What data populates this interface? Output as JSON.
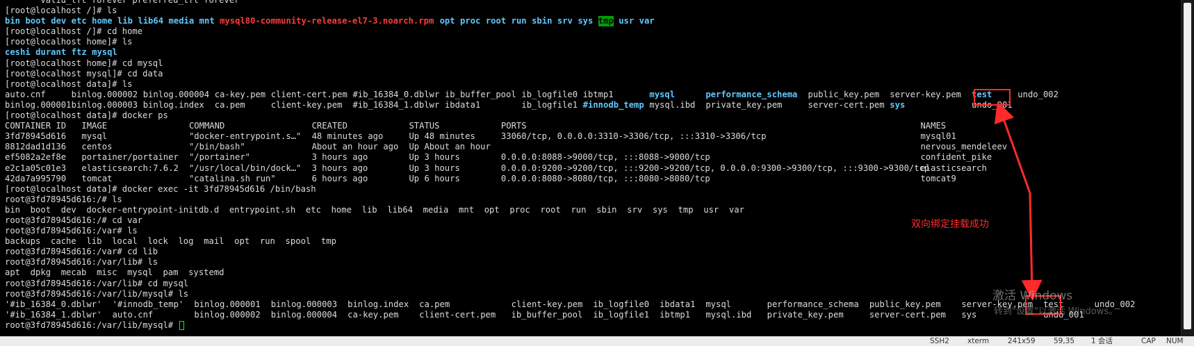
{
  "terminal": {
    "lines": [
      {
        "tokens": [
          {
            "text": "       valid_lft forever preferred_lft forever",
            "c": "default",
            "col": 0
          }
        ]
      },
      {
        "tokens": [
          {
            "text": "[root@localhost /]# ls",
            "c": "default",
            "col": 0
          }
        ]
      },
      {
        "tokens": [
          {
            "text": "bin",
            "c": "dir",
            "col": 0
          },
          {
            "text": "boot",
            "c": "dir",
            "col": 4
          },
          {
            "text": "dev",
            "c": "dir",
            "col": 9
          },
          {
            "text": "etc",
            "c": "dir",
            "col": 13
          },
          {
            "text": "home",
            "c": "dir",
            "col": 17
          },
          {
            "text": "lib",
            "c": "dir",
            "col": 22
          },
          {
            "text": "lib64",
            "c": "dir",
            "col": 26
          },
          {
            "text": "media",
            "c": "dir",
            "col": 32
          },
          {
            "text": "mnt",
            "c": "dir",
            "col": 38
          },
          {
            "text": "mysql80-community-release-el7-3.noarch.rpm",
            "c": "red",
            "col": 42
          },
          {
            "text": "opt",
            "c": "dir",
            "col": 85
          },
          {
            "text": "proc",
            "c": "dir",
            "col": 89
          },
          {
            "text": "root",
            "c": "dir",
            "col": 94
          },
          {
            "text": "run",
            "c": "dir",
            "col": 99
          },
          {
            "text": "sbin",
            "c": "dir",
            "col": 103
          },
          {
            "text": "srv",
            "c": "dir",
            "col": 108
          },
          {
            "text": "sys",
            "c": "dir",
            "col": 112
          },
          {
            "text": "tmp",
            "c": "tmpbg",
            "col": 116
          },
          {
            "text": "usr",
            "c": "dir",
            "col": 120
          },
          {
            "text": "var",
            "c": "dir",
            "col": 124
          }
        ]
      },
      {
        "tokens": [
          {
            "text": "[root@localhost /]# cd home",
            "c": "default",
            "col": 0
          }
        ]
      },
      {
        "tokens": [
          {
            "text": "[root@localhost home]# ls",
            "c": "default",
            "col": 0
          }
        ]
      },
      {
        "tokens": [
          {
            "text": "ceshi",
            "c": "dir",
            "col": 0
          },
          {
            "text": "durant",
            "c": "dir",
            "col": 6
          },
          {
            "text": "ftz",
            "c": "dir",
            "col": 13
          },
          {
            "text": "mysql",
            "c": "dir",
            "col": 17
          }
        ]
      },
      {
        "tokens": [
          {
            "text": "[root@localhost home]# cd mysql",
            "c": "default",
            "col": 0
          }
        ]
      },
      {
        "tokens": [
          {
            "text": "[root@localhost mysql]# cd data",
            "c": "default",
            "col": 0
          }
        ]
      },
      {
        "tokens": [
          {
            "text": "[root@localhost data]# ls",
            "c": "default",
            "col": 0
          }
        ]
      },
      {
        "tokens": [
          {
            "text": "auto.cnf",
            "c": "default",
            "col": 0
          },
          {
            "text": "binlog.000002",
            "c": "default",
            "col": 13
          },
          {
            "text": "binlog.000004",
            "c": "default",
            "col": 27
          },
          {
            "text": "ca-key.pem",
            "c": "default",
            "col": 41
          },
          {
            "text": "client-cert.pem",
            "c": "default",
            "col": 52
          },
          {
            "text": "#ib_16384_0.dblwr",
            "c": "default",
            "col": 68
          },
          {
            "text": "ib_buffer_pool",
            "c": "default",
            "col": 86
          },
          {
            "text": "ib_logfile0",
            "c": "default",
            "col": 101
          },
          {
            "text": "ibtmp1",
            "c": "default",
            "col": 113
          },
          {
            "text": "mysql",
            "c": "dir",
            "col": 126
          },
          {
            "text": "performance_schema",
            "c": "dir",
            "col": 137
          },
          {
            "text": "public_key.pem",
            "c": "default",
            "col": 157
          },
          {
            "text": "server-key.pem",
            "c": "default",
            "col": 173
          },
          {
            "text": "test",
            "c": "dir",
            "col": 189
          },
          {
            "text": "undo_002",
            "c": "default",
            "col": 198
          }
        ]
      },
      {
        "tokens": [
          {
            "text": "binlog.000001",
            "c": "default",
            "col": 0
          },
          {
            "text": "binlog.000003",
            "c": "default",
            "col": 13
          },
          {
            "text": "binlog.index",
            "c": "default",
            "col": 27
          },
          {
            "text": "ca.pem",
            "c": "default",
            "col": 41
          },
          {
            "text": "client-key.pem",
            "c": "default",
            "col": 52
          },
          {
            "text": "#ib_16384_1.dblwr",
            "c": "default",
            "col": 68
          },
          {
            "text": "ibdata1",
            "c": "default",
            "col": 86
          },
          {
            "text": "ib_logfile1",
            "c": "default",
            "col": 101
          },
          {
            "text": "#innodb_temp",
            "c": "dir",
            "col": 113
          },
          {
            "text": "mysql.ibd",
            "c": "default",
            "col": 126
          },
          {
            "text": "private_key.pem",
            "c": "default",
            "col": 137
          },
          {
            "text": "server-cert.pem",
            "c": "default",
            "col": 157
          },
          {
            "text": "sys",
            "c": "dir",
            "col": 173
          },
          {
            "text": "undo_001",
            "c": "default",
            "col": 189
          }
        ]
      },
      {
        "tokens": [
          {
            "text": "[root@localhost data]# docker ps",
            "c": "default",
            "col": 0
          }
        ]
      },
      {
        "tokens": [
          {
            "text": "CONTAINER ID",
            "c": "default",
            "col": 0
          },
          {
            "text": "IMAGE",
            "c": "default",
            "col": 15
          },
          {
            "text": "COMMAND",
            "c": "default",
            "col": 36
          },
          {
            "text": "CREATED",
            "c": "default",
            "col": 60
          },
          {
            "text": "STATUS",
            "c": "default",
            "col": 79
          },
          {
            "text": "PORTS",
            "c": "default",
            "col": 97
          },
          {
            "text": "NAMES",
            "c": "default",
            "col": 179
          }
        ]
      },
      {
        "tokens": [
          {
            "text": "3fd78945d616",
            "c": "default",
            "col": 0
          },
          {
            "text": "mysql",
            "c": "default",
            "col": 15
          },
          {
            "text": "\"docker-entrypoint.s…\"",
            "c": "default",
            "col": 36
          },
          {
            "text": "48 minutes ago",
            "c": "default",
            "col": 60
          },
          {
            "text": "Up 48 minutes",
            "c": "default",
            "col": 79
          },
          {
            "text": "33060/tcp, 0.0.0.0:3310->3306/tcp, :::3310->3306/tcp",
            "c": "default",
            "col": 97
          },
          {
            "text": "mysql01",
            "c": "default",
            "col": 179
          }
        ]
      },
      {
        "tokens": [
          {
            "text": "8812dad1d136",
            "c": "default",
            "col": 0
          },
          {
            "text": "centos",
            "c": "default",
            "col": 15
          },
          {
            "text": "\"/bin/bash\"",
            "c": "default",
            "col": 36
          },
          {
            "text": "About an hour ago",
            "c": "default",
            "col": 60
          },
          {
            "text": "Up About an hour",
            "c": "default",
            "col": 79
          },
          {
            "text": "nervous_mendeleev",
            "c": "default",
            "col": 179
          }
        ]
      },
      {
        "tokens": [
          {
            "text": "ef5082a2ef8e",
            "c": "default",
            "col": 0
          },
          {
            "text": "portainer/portainer",
            "c": "default",
            "col": 15
          },
          {
            "text": "\"/portainer\"",
            "c": "default",
            "col": 36
          },
          {
            "text": "3 hours ago",
            "c": "default",
            "col": 60
          },
          {
            "text": "Up 3 hours",
            "c": "default",
            "col": 79
          },
          {
            "text": "0.0.0.0:8088->9000/tcp, :::8088->9000/tcp",
            "c": "default",
            "col": 97
          },
          {
            "text": "confident_pike",
            "c": "default",
            "col": 179
          }
        ]
      },
      {
        "tokens": [
          {
            "text": "e2c1a05c01e3",
            "c": "default",
            "col": 0
          },
          {
            "text": "elasticsearch:7.6.2",
            "c": "default",
            "col": 15
          },
          {
            "text": "\"/usr/local/bin/dock…\"",
            "c": "default",
            "col": 36
          },
          {
            "text": "3 hours ago",
            "c": "default",
            "col": 60
          },
          {
            "text": "Up 3 hours",
            "c": "default",
            "col": 79
          },
          {
            "text": "0.0.0.0:9200->9200/tcp, :::9200->9200/tcp, 0.0.0.0:9300->9300/tcp, :::9300->9300/tcp",
            "c": "default",
            "col": 97
          },
          {
            "text": "elasticsearch",
            "c": "default",
            "col": 179
          }
        ]
      },
      {
        "tokens": [
          {
            "text": "42da7a995790",
            "c": "default",
            "col": 0
          },
          {
            "text": "tomcat",
            "c": "default",
            "col": 15
          },
          {
            "text": "\"catalina.sh run\"",
            "c": "default",
            "col": 36
          },
          {
            "text": "6 hours ago",
            "c": "default",
            "col": 60
          },
          {
            "text": "Up 6 hours",
            "c": "default",
            "col": 79
          },
          {
            "text": "0.0.0.0:8080->8080/tcp, :::8080->8080/tcp",
            "c": "default",
            "col": 97
          },
          {
            "text": "tomcat9",
            "c": "default",
            "col": 179
          }
        ]
      },
      {
        "tokens": [
          {
            "text": "[root@localhost data]# docker exec -it 3fd78945d616 /bin/bash",
            "c": "default",
            "col": 0
          }
        ]
      },
      {
        "tokens": [
          {
            "text": "root@3fd78945d616:/# ls",
            "c": "default",
            "col": 0
          }
        ]
      },
      {
        "tokens": [
          {
            "text": "bin  boot  dev  docker-entrypoint-initdb.d  entrypoint.sh  etc  home  lib  lib64  media  mnt  opt  proc  root  run  sbin  srv  sys  tmp  usr  var",
            "c": "default",
            "col": 0
          }
        ]
      },
      {
        "tokens": [
          {
            "text": "root@3fd78945d616:/# cd var",
            "c": "default",
            "col": 0
          }
        ]
      },
      {
        "tokens": [
          {
            "text": "root@3fd78945d616:/var# ls",
            "c": "default",
            "col": 0
          }
        ]
      },
      {
        "tokens": [
          {
            "text": "backups  cache  lib  local  lock  log  mail  opt  run  spool  tmp",
            "c": "default",
            "col": 0
          }
        ]
      },
      {
        "tokens": [
          {
            "text": "root@3fd78945d616:/var# cd lib",
            "c": "default",
            "col": 0
          }
        ]
      },
      {
        "tokens": [
          {
            "text": "root@3fd78945d616:/var/lib# ls",
            "c": "default",
            "col": 0
          }
        ]
      },
      {
        "tokens": [
          {
            "text": "apt  dpkg  mecab  misc  mysql  pam  systemd",
            "c": "default",
            "col": 0
          }
        ]
      },
      {
        "tokens": [
          {
            "text": "root@3fd78945d616:/var/lib# cd mysql",
            "c": "default",
            "col": 0
          }
        ]
      },
      {
        "tokens": [
          {
            "text": "root@3fd78945d616:/var/lib/mysql# ls",
            "c": "default",
            "col": 0
          }
        ]
      },
      {
        "tokens": [
          {
            "text": "'#ib_16384_0.dblwr'",
            "c": "default",
            "col": 0
          },
          {
            "text": "'#innodb_temp'",
            "c": "default",
            "col": 21
          },
          {
            "text": "binlog.000001",
            "c": "default",
            "col": 37
          },
          {
            "text": "binlog.000003",
            "c": "default",
            "col": 52
          },
          {
            "text": "binlog.index",
            "c": "default",
            "col": 67
          },
          {
            "text": "ca.pem",
            "c": "default",
            "col": 81
          },
          {
            "text": "client-key.pem",
            "c": "default",
            "col": 99
          },
          {
            "text": "ib_logfile0",
            "c": "default",
            "col": 115
          },
          {
            "text": "ibdata1",
            "c": "default",
            "col": 128
          },
          {
            "text": "mysql",
            "c": "default",
            "col": 137
          },
          {
            "text": "performance_schema",
            "c": "default",
            "col": 149
          },
          {
            "text": "public_key.pem",
            "c": "default",
            "col": 169
          },
          {
            "text": "server-key.pem",
            "c": "default",
            "col": 187
          },
          {
            "text": "test",
            "c": "default",
            "col": 203
          },
          {
            "text": "undo_002",
            "c": "default",
            "col": 213
          }
        ]
      },
      {
        "tokens": [
          {
            "text": "'#ib_16384_1.dblwr'",
            "c": "default",
            "col": 0
          },
          {
            "text": "auto.cnf",
            "c": "default",
            "col": 21
          },
          {
            "text": "binlog.000002",
            "c": "default",
            "col": 37
          },
          {
            "text": "binlog.000004",
            "c": "default",
            "col": 52
          },
          {
            "text": "ca-key.pem",
            "c": "default",
            "col": 67
          },
          {
            "text": "client-cert.pem",
            "c": "default",
            "col": 81
          },
          {
            "text": "ib_buffer_pool",
            "c": "default",
            "col": 99
          },
          {
            "text": "ib_logfile1",
            "c": "default",
            "col": 115
          },
          {
            "text": "ibtmp1",
            "c": "default",
            "col": 128
          },
          {
            "text": "mysql.ibd",
            "c": "default",
            "col": 137
          },
          {
            "text": "private_key.pem",
            "c": "default",
            "col": 149
          },
          {
            "text": "server-cert.pem",
            "c": "default",
            "col": 169
          },
          {
            "text": "sys",
            "c": "default",
            "col": 187
          },
          {
            "text": "undo_001",
            "c": "default",
            "col": 203
          }
        ]
      },
      {
        "tokens": [
          {
            "text": "root@3fd78945d616:/var/lib/mysql# ",
            "c": "default",
            "col": 0
          }
        ],
        "cursor": true
      }
    ]
  },
  "annotation": {
    "label": "双向绑定挂载成功",
    "color": "#ff2b2b"
  },
  "watermark": {
    "line1": "激活 Windows",
    "line2": "转到\"设置\"以激活 Windows。"
  },
  "statusbar": {
    "items": [
      "SSH2",
      "xterm",
      "241x59",
      "59,35",
      "1 会话",
      "CAP",
      "NUM"
    ]
  },
  "colors": {
    "background": "#000000",
    "text": "#dcdcdc",
    "directory": "#5fc8ff",
    "archive": "#ff3b3b",
    "tmp_highlight": "#00a000",
    "cursor": "#00ff00",
    "statusbar": "#ececec"
  }
}
